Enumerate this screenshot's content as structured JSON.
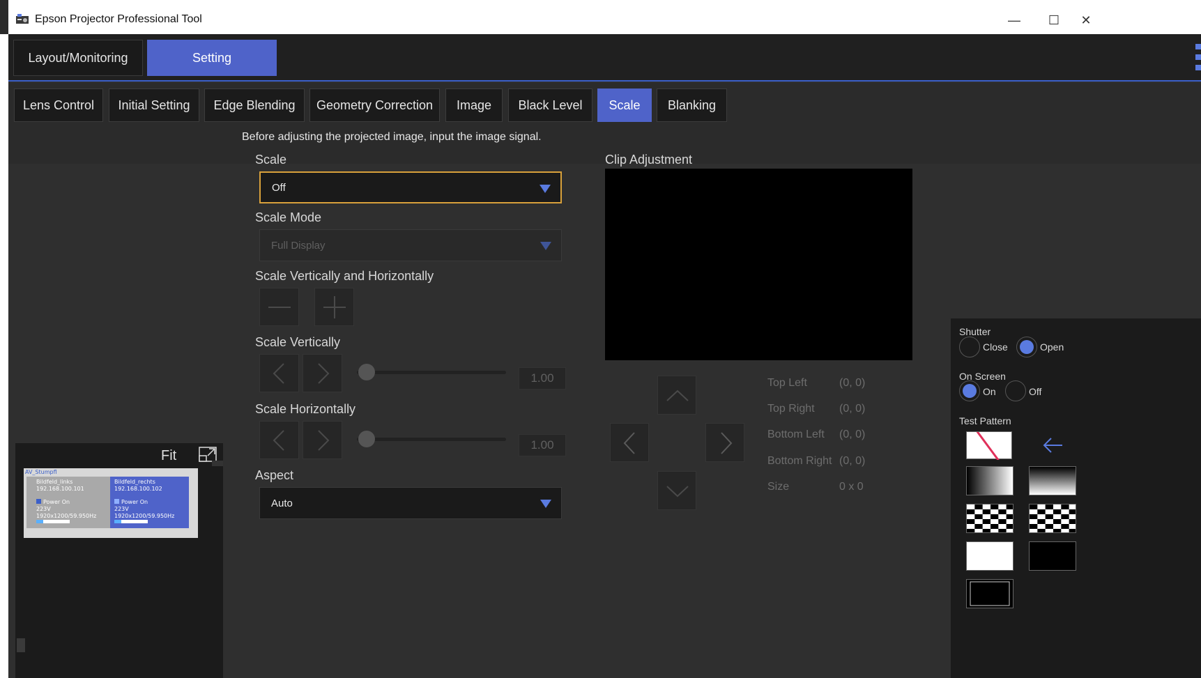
{
  "window": {
    "title": "Epson Projector Professional Tool",
    "minimize": "—",
    "maximize": "☐",
    "close": "✕"
  },
  "top_tabs": [
    {
      "label": "Layout/Monitoring",
      "active": false
    },
    {
      "label": "Setting",
      "active": true
    }
  ],
  "sub_tabs": [
    {
      "label": "Lens Control"
    },
    {
      "label": "Initial Setting"
    },
    {
      "label": "Edge Blending"
    },
    {
      "label": "Geometry Correction"
    },
    {
      "label": "Image"
    },
    {
      "label": "Black Level"
    },
    {
      "label": "Scale",
      "active": true
    },
    {
      "label": "Blanking"
    }
  ],
  "scale_panel": {
    "note": "Before adjusting the projected image, input the image signal.",
    "scale_label": "Scale",
    "scale_value": "Off",
    "scale_mode_label": "Scale Mode",
    "scale_mode_value": "Full Display",
    "vh_label": "Scale Vertically and Horizontally",
    "vert_label": "Scale Vertically",
    "vert_value": "1.00",
    "horiz_label": "Scale Horizontally",
    "horiz_value": "1.00",
    "aspect_label": "Aspect",
    "aspect_value": "Auto"
  },
  "clip": {
    "title": "Clip Adjustment",
    "rows": [
      {
        "label": "Top Left",
        "value": "(0, 0)"
      },
      {
        "label": "Top Right",
        "value": "(0, 0)"
      },
      {
        "label": "Bottom Left",
        "value": "(0, 0)"
      },
      {
        "label": "Bottom Right",
        "value": "(0, 0)"
      },
      {
        "label": "Size",
        "value": "0 x 0"
      }
    ]
  },
  "monitor": {
    "fit_label": "Fit",
    "group_name": "AV_Stumpfl",
    "projectors": [
      {
        "name": "Bildfeld_links",
        "ip": "192.168.100.101",
        "power": "Power On",
        "voltage": "223V",
        "signal": "1920x1200/59.950Hz",
        "selected": false
      },
      {
        "name": "Bildfeld_rechts",
        "ip": "192.168.100.102",
        "power": "Power On",
        "voltage": "223V",
        "signal": "1920x1200/59.950Hz",
        "selected": true
      }
    ]
  },
  "side": {
    "shutter_label": "Shutter",
    "shutter_close": "Close",
    "shutter_open": "Open",
    "onscreen_label": "On Screen",
    "onscreen_on": "On",
    "onscreen_off": "Off",
    "test_pattern_label": "Test Pattern"
  },
  "colors": {
    "accent": "#4f63c9",
    "focus": "#d9a13b",
    "radio_on": "#5a7be0"
  }
}
